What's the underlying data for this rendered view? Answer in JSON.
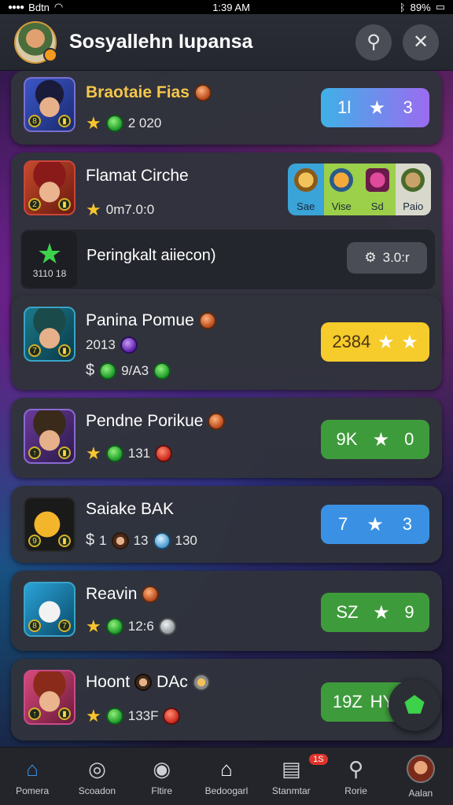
{
  "status": {
    "carrier": "Bdtn",
    "time": "1:39 AM",
    "battery": "89%"
  },
  "header": {
    "title": "Sosyallehn Iupansa"
  },
  "rows": [
    {
      "title": "Braotaie Fias",
      "meta": "2 020",
      "pill": [
        "1l",
        "3"
      ]
    },
    {
      "title": "Flamat Cirche",
      "meta": "0m7.0:0",
      "rewards": [
        "Sae",
        "Vise",
        "Sd",
        "Paio"
      ]
    },
    {
      "title": "Panina Pomue",
      "meta1": "2013",
      "meta2": "9/A3",
      "pill": [
        "2384",
        ""
      ]
    },
    {
      "title": "Pendne Porikue",
      "meta": "131",
      "pill": [
        "9K",
        "0"
      ]
    },
    {
      "title": "Saiake BAK",
      "meta1": "1",
      "meta2": "13",
      "meta3": "130",
      "pill": [
        "7",
        "3"
      ]
    },
    {
      "title": "Reavin",
      "meta": "12:6",
      "pill": [
        "SZ",
        "9"
      ]
    },
    {
      "title": "Hoont",
      "title2": "DAc",
      "meta": "133F",
      "pill": [
        "19Z",
        "HY"
      ]
    }
  ],
  "sub": {
    "title": "Peringkalt aiiecon)",
    "icon_label": "3110 18",
    "button": "3.0:r"
  },
  "tabs": [
    {
      "label": "Pomera"
    },
    {
      "label": "Scoadon"
    },
    {
      "label": "Fltire"
    },
    {
      "label": "Bedoogarl"
    },
    {
      "label": "Stanmtar",
      "badge": "1S"
    },
    {
      "label": "Rorie"
    },
    {
      "label": "Aalan"
    }
  ]
}
